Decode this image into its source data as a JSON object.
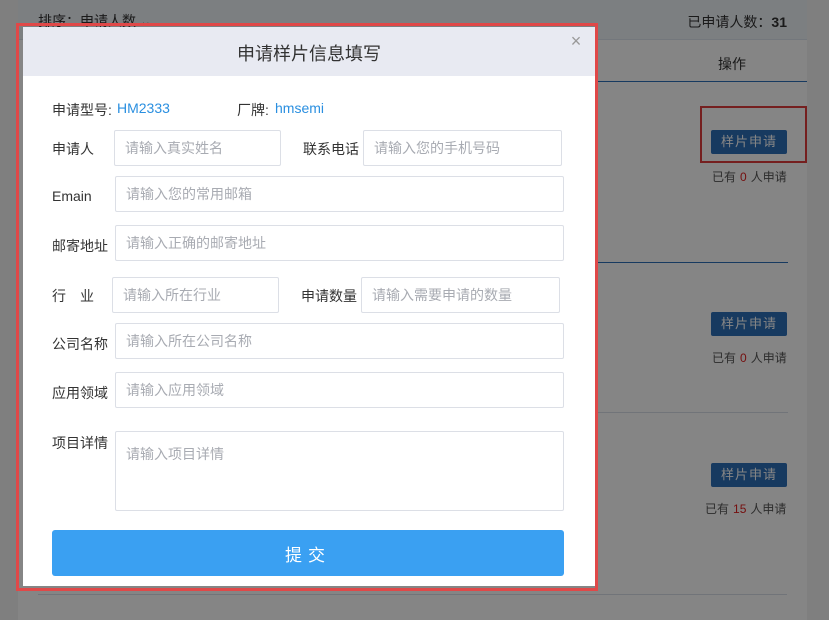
{
  "background": {
    "sort_label": "排序：申请人数 ⌄",
    "applicant_count_label": "已申请人数：",
    "applicant_count": "31",
    "operation_header": "操作",
    "sample_button_label": "样片申请",
    "rows": [
      {
        "applied_prefix": "已有",
        "applied_count": "0",
        "applied_suffix": "人申请"
      },
      {
        "applied_prefix": "已有",
        "applied_count": "0",
        "applied_suffix": "人申请"
      },
      {
        "applied_prefix": "已有",
        "applied_count": "15",
        "applied_suffix": "人申请"
      }
    ]
  },
  "modal": {
    "title": "申请样片信息填写",
    "close_symbol": "×",
    "model_label": "申请型号:",
    "model_value": "HM2333",
    "brand_label": "厂牌:",
    "brand_value": "hmsemi",
    "fields": {
      "applicant": {
        "label": "申请人",
        "placeholder": "请输入真实姓名"
      },
      "phone": {
        "label": "联系电话",
        "placeholder": "请输入您的手机号码"
      },
      "email": {
        "label": "Emain",
        "placeholder": "请输入您的常用邮箱"
      },
      "address": {
        "label": "邮寄地址",
        "placeholder": "请输入正确的邮寄地址"
      },
      "industry": {
        "label": "行　业",
        "placeholder": "请输入所在行业"
      },
      "quantity": {
        "label": "申请数量",
        "placeholder": "请输入需要申请的数量"
      },
      "company": {
        "label": "公司名称",
        "placeholder": "请输入所在公司名称"
      },
      "application": {
        "label": "应用领域",
        "placeholder": "请输入应用领域"
      },
      "project": {
        "label": "项目详情",
        "placeholder": "请输入项目详情"
      }
    },
    "submit_label": "提交"
  },
  "colors": {
    "accent_blue": "#3aa0f2",
    "dark_blue_button": "#2d6fb9",
    "highlight_red": "#e03c3c",
    "count_red": "#e02020"
  }
}
